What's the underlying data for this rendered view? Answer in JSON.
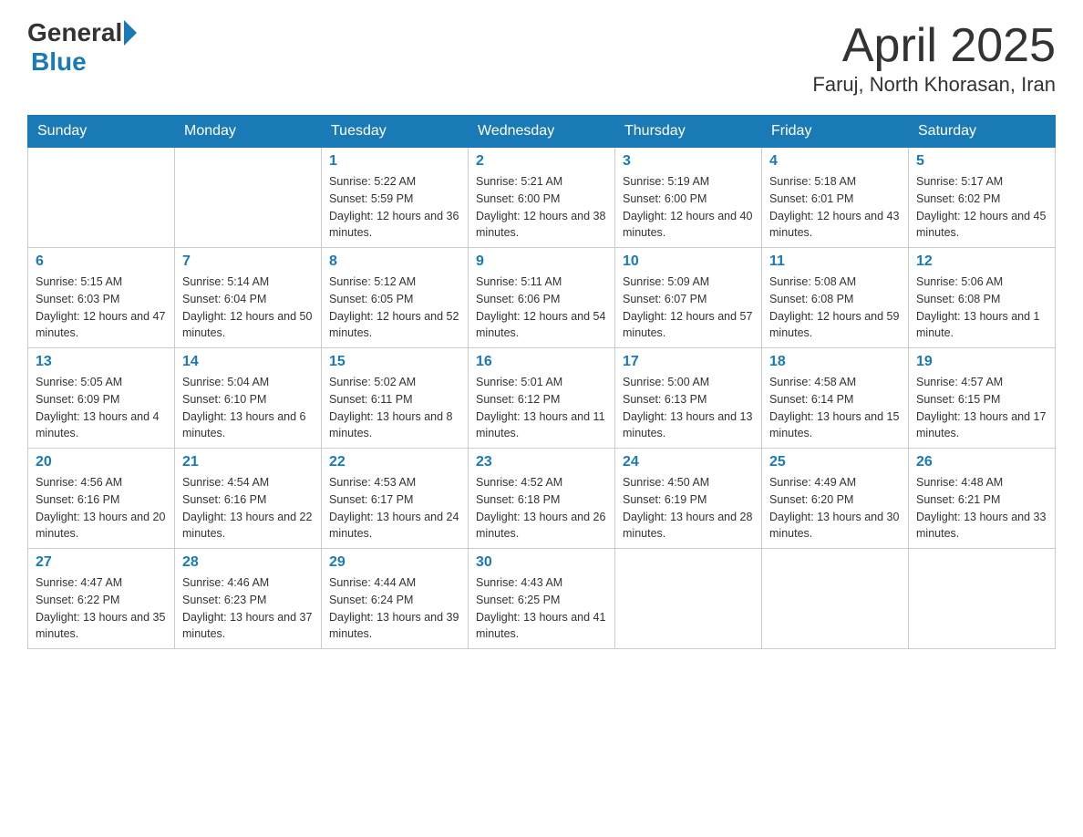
{
  "logo": {
    "general": "General",
    "blue": "Blue",
    "subtitle": "Blue"
  },
  "title": {
    "month_year": "April 2025",
    "location": "Faruj, North Khorasan, Iran"
  },
  "days_of_week": [
    "Sunday",
    "Monday",
    "Tuesday",
    "Wednesday",
    "Thursday",
    "Friday",
    "Saturday"
  ],
  "weeks": [
    [
      {
        "day": "",
        "sunrise": "",
        "sunset": "",
        "daylight": ""
      },
      {
        "day": "",
        "sunrise": "",
        "sunset": "",
        "daylight": ""
      },
      {
        "day": "1",
        "sunrise": "Sunrise: 5:22 AM",
        "sunset": "Sunset: 5:59 PM",
        "daylight": "Daylight: 12 hours and 36 minutes."
      },
      {
        "day": "2",
        "sunrise": "Sunrise: 5:21 AM",
        "sunset": "Sunset: 6:00 PM",
        "daylight": "Daylight: 12 hours and 38 minutes."
      },
      {
        "day": "3",
        "sunrise": "Sunrise: 5:19 AM",
        "sunset": "Sunset: 6:00 PM",
        "daylight": "Daylight: 12 hours and 40 minutes."
      },
      {
        "day": "4",
        "sunrise": "Sunrise: 5:18 AM",
        "sunset": "Sunset: 6:01 PM",
        "daylight": "Daylight: 12 hours and 43 minutes."
      },
      {
        "day": "5",
        "sunrise": "Sunrise: 5:17 AM",
        "sunset": "Sunset: 6:02 PM",
        "daylight": "Daylight: 12 hours and 45 minutes."
      }
    ],
    [
      {
        "day": "6",
        "sunrise": "Sunrise: 5:15 AM",
        "sunset": "Sunset: 6:03 PM",
        "daylight": "Daylight: 12 hours and 47 minutes."
      },
      {
        "day": "7",
        "sunrise": "Sunrise: 5:14 AM",
        "sunset": "Sunset: 6:04 PM",
        "daylight": "Daylight: 12 hours and 50 minutes."
      },
      {
        "day": "8",
        "sunrise": "Sunrise: 5:12 AM",
        "sunset": "Sunset: 6:05 PM",
        "daylight": "Daylight: 12 hours and 52 minutes."
      },
      {
        "day": "9",
        "sunrise": "Sunrise: 5:11 AM",
        "sunset": "Sunset: 6:06 PM",
        "daylight": "Daylight: 12 hours and 54 minutes."
      },
      {
        "day": "10",
        "sunrise": "Sunrise: 5:09 AM",
        "sunset": "Sunset: 6:07 PM",
        "daylight": "Daylight: 12 hours and 57 minutes."
      },
      {
        "day": "11",
        "sunrise": "Sunrise: 5:08 AM",
        "sunset": "Sunset: 6:08 PM",
        "daylight": "Daylight: 12 hours and 59 minutes."
      },
      {
        "day": "12",
        "sunrise": "Sunrise: 5:06 AM",
        "sunset": "Sunset: 6:08 PM",
        "daylight": "Daylight: 13 hours and 1 minute."
      }
    ],
    [
      {
        "day": "13",
        "sunrise": "Sunrise: 5:05 AM",
        "sunset": "Sunset: 6:09 PM",
        "daylight": "Daylight: 13 hours and 4 minutes."
      },
      {
        "day": "14",
        "sunrise": "Sunrise: 5:04 AM",
        "sunset": "Sunset: 6:10 PM",
        "daylight": "Daylight: 13 hours and 6 minutes."
      },
      {
        "day": "15",
        "sunrise": "Sunrise: 5:02 AM",
        "sunset": "Sunset: 6:11 PM",
        "daylight": "Daylight: 13 hours and 8 minutes."
      },
      {
        "day": "16",
        "sunrise": "Sunrise: 5:01 AM",
        "sunset": "Sunset: 6:12 PM",
        "daylight": "Daylight: 13 hours and 11 minutes."
      },
      {
        "day": "17",
        "sunrise": "Sunrise: 5:00 AM",
        "sunset": "Sunset: 6:13 PM",
        "daylight": "Daylight: 13 hours and 13 minutes."
      },
      {
        "day": "18",
        "sunrise": "Sunrise: 4:58 AM",
        "sunset": "Sunset: 6:14 PM",
        "daylight": "Daylight: 13 hours and 15 minutes."
      },
      {
        "day": "19",
        "sunrise": "Sunrise: 4:57 AM",
        "sunset": "Sunset: 6:15 PM",
        "daylight": "Daylight: 13 hours and 17 minutes."
      }
    ],
    [
      {
        "day": "20",
        "sunrise": "Sunrise: 4:56 AM",
        "sunset": "Sunset: 6:16 PM",
        "daylight": "Daylight: 13 hours and 20 minutes."
      },
      {
        "day": "21",
        "sunrise": "Sunrise: 4:54 AM",
        "sunset": "Sunset: 6:16 PM",
        "daylight": "Daylight: 13 hours and 22 minutes."
      },
      {
        "day": "22",
        "sunrise": "Sunrise: 4:53 AM",
        "sunset": "Sunset: 6:17 PM",
        "daylight": "Daylight: 13 hours and 24 minutes."
      },
      {
        "day": "23",
        "sunrise": "Sunrise: 4:52 AM",
        "sunset": "Sunset: 6:18 PM",
        "daylight": "Daylight: 13 hours and 26 minutes."
      },
      {
        "day": "24",
        "sunrise": "Sunrise: 4:50 AM",
        "sunset": "Sunset: 6:19 PM",
        "daylight": "Daylight: 13 hours and 28 minutes."
      },
      {
        "day": "25",
        "sunrise": "Sunrise: 4:49 AM",
        "sunset": "Sunset: 6:20 PM",
        "daylight": "Daylight: 13 hours and 30 minutes."
      },
      {
        "day": "26",
        "sunrise": "Sunrise: 4:48 AM",
        "sunset": "Sunset: 6:21 PM",
        "daylight": "Daylight: 13 hours and 33 minutes."
      }
    ],
    [
      {
        "day": "27",
        "sunrise": "Sunrise: 4:47 AM",
        "sunset": "Sunset: 6:22 PM",
        "daylight": "Daylight: 13 hours and 35 minutes."
      },
      {
        "day": "28",
        "sunrise": "Sunrise: 4:46 AM",
        "sunset": "Sunset: 6:23 PM",
        "daylight": "Daylight: 13 hours and 37 minutes."
      },
      {
        "day": "29",
        "sunrise": "Sunrise: 4:44 AM",
        "sunset": "Sunset: 6:24 PM",
        "daylight": "Daylight: 13 hours and 39 minutes."
      },
      {
        "day": "30",
        "sunrise": "Sunrise: 4:43 AM",
        "sunset": "Sunset: 6:25 PM",
        "daylight": "Daylight: 13 hours and 41 minutes."
      },
      {
        "day": "",
        "sunrise": "",
        "sunset": "",
        "daylight": ""
      },
      {
        "day": "",
        "sunrise": "",
        "sunset": "",
        "daylight": ""
      },
      {
        "day": "",
        "sunrise": "",
        "sunset": "",
        "daylight": ""
      }
    ]
  ]
}
